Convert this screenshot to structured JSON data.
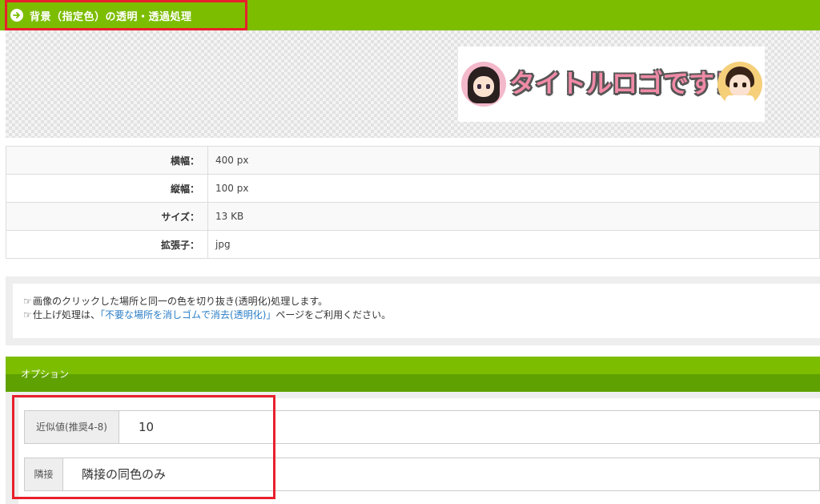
{
  "header": {
    "title": "背景（指定色）の透明・透過処理",
    "arrow_icon": "circle-arrow-right-icon",
    "bar_color": "#7cbd00",
    "highlight_color": "#e8202c"
  },
  "preview": {
    "logo_text": "タイトルロゴです！"
  },
  "info": {
    "rows": [
      {
        "label": "横幅：",
        "value": "400 px"
      },
      {
        "label": "縦幅：",
        "value": "100 px"
      },
      {
        "label": "サイズ：",
        "value": "13 KB"
      },
      {
        "label": "拡張子：",
        "value": "jpg"
      }
    ]
  },
  "notice": {
    "line1": "画像のクリックした場所と同一の色を切り抜き(透明化)処理します。",
    "line2_prefix": "仕上げ処理は、",
    "line2_link": "「不要な場所を消しゴムで消去(透明化)」",
    "line2_suffix": "ページをご利用ください。",
    "hand_icon": "hand-pointing-icon"
  },
  "options": {
    "title": "オプション",
    "tolerance_label": "近似値(推奨4-8)",
    "tolerance_value": "10",
    "adjacent_label": "隣接",
    "adjacent_value": "隣接の同色のみ"
  }
}
